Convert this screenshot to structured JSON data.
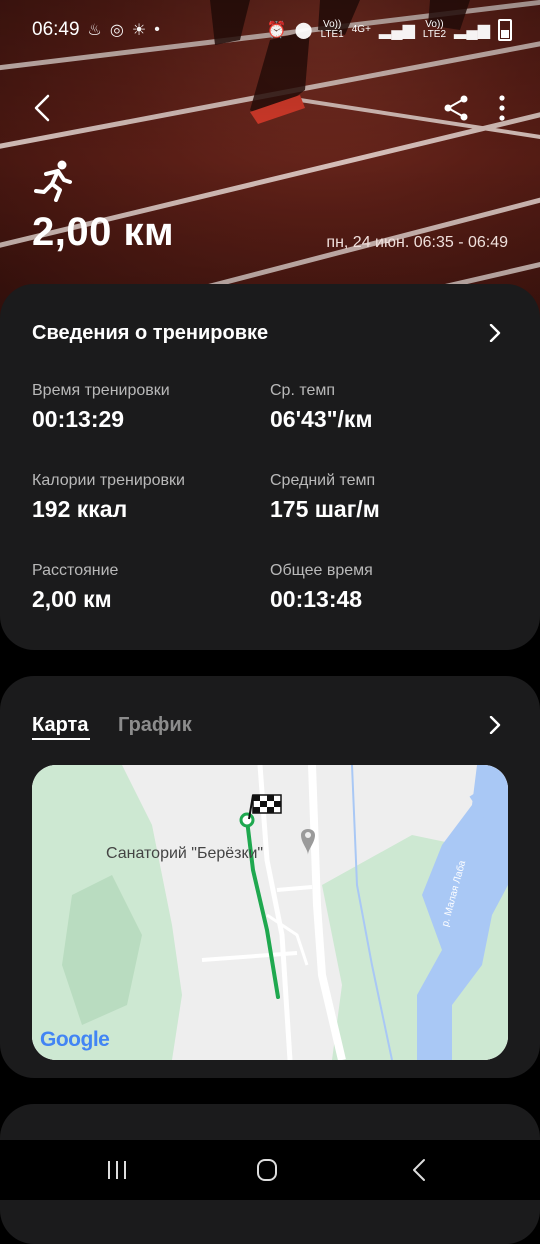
{
  "status_bar": {
    "time": "06:49",
    "sim1": "Vo))\nLTE1",
    "sim2": "Vo))\nLTE2",
    "net_type": "4G+"
  },
  "header": {
    "distance": "2,00 км",
    "datetime": "пн, 24 июн. 06:35 - 06:49"
  },
  "details": {
    "title": "Сведения о тренировке",
    "stats": [
      {
        "label": "Время тренировки",
        "value": "00:13:29"
      },
      {
        "label": "Ср. темп",
        "value": "06'43\"/км"
      },
      {
        "label": "Калории тренировки",
        "value": "192 ккал"
      },
      {
        "label": "Средний темп",
        "value": "175 шаг/м"
      },
      {
        "label": "Расстояние",
        "value": "2,00 км"
      },
      {
        "label": "Общее время",
        "value": "00:13:48"
      }
    ]
  },
  "map_card": {
    "tabs": [
      "Карта",
      "График"
    ],
    "active_tab": "Карта",
    "place_label": "Санаторий \"Берёзки\"",
    "river_label": "р. Малая Лаба",
    "google_logo": "Google"
  },
  "colors": {
    "card_bg": "#1b1b1c",
    "route_green": "#1fa84f",
    "map_water": "#a9c8f5",
    "map_green": "#cde8d2"
  }
}
